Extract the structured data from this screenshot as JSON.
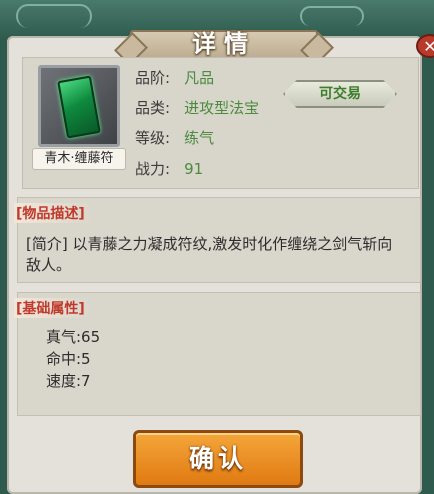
{
  "title": "详情",
  "close_icon": "close-icon",
  "item": {
    "name": "青木·缠藤符",
    "icon": "talisman-item-icon",
    "attributes": [
      {
        "label": "品阶:",
        "value": "凡品"
      },
      {
        "label": "品类:",
        "value": "进攻型法宝"
      },
      {
        "label": "等级:",
        "value": "练气"
      },
      {
        "label": "战力:",
        "value": "91"
      }
    ],
    "trade_badge": "可交易"
  },
  "description": {
    "title": "[物品描述]",
    "text": "[简介] 以青藤之力凝成符纹,激发时化作缠绕之剑气斩向敌人。"
  },
  "base_attributes": {
    "title": "[基础属性]",
    "stats": [
      "真气:65",
      "命中:5",
      "速度:7"
    ]
  },
  "confirm_label": "确认",
  "colors": {
    "value_green": "#4c8a3e",
    "section_title_red": "#c0392b",
    "confirm_orange": "#e07a12"
  }
}
